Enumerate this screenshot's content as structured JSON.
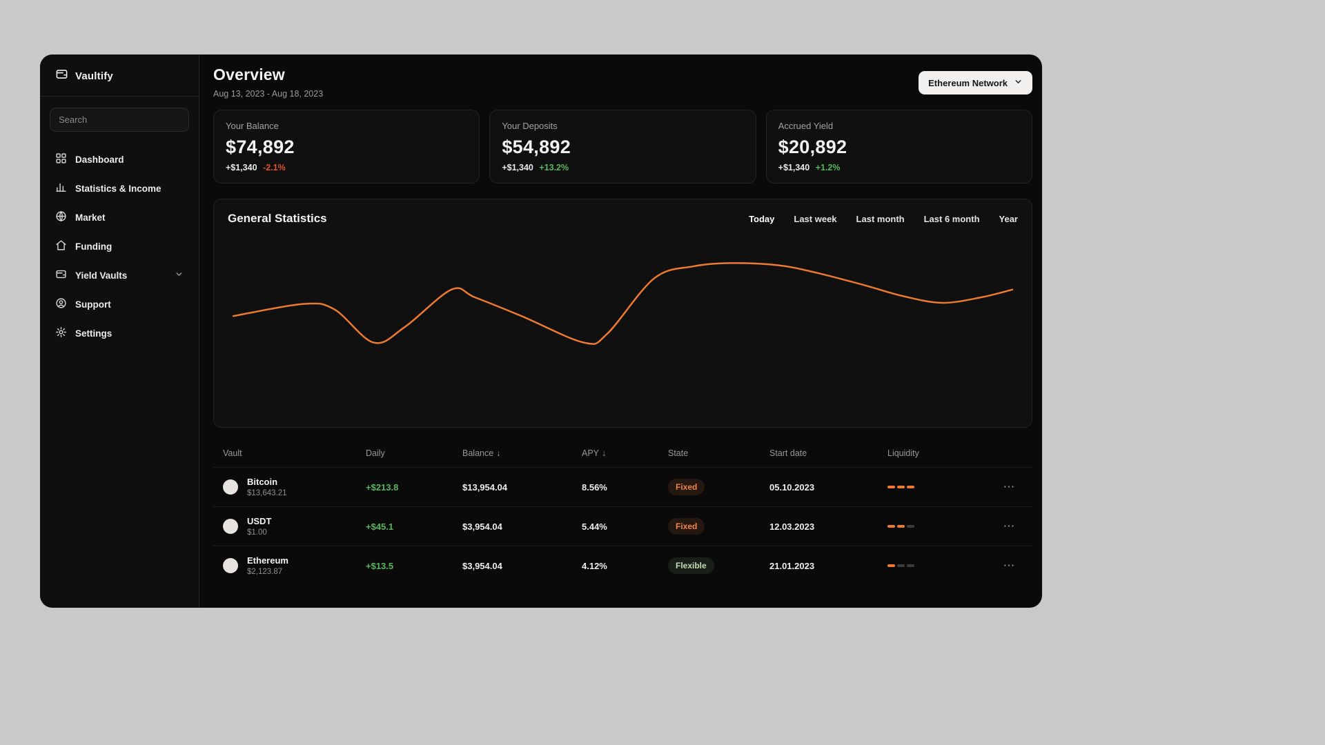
{
  "app": {
    "name": "Vaultify"
  },
  "colors": {
    "accent_orange": "#ed7a33",
    "positive_green": "#58b65c",
    "negative_red": "#e0532f",
    "window_bg": "#0a0a0a",
    "card_bg": "#101010"
  },
  "icons": {
    "sort_arrow": "↓",
    "ellipsis": "⋯"
  },
  "sidebar": {
    "search_placeholder": "Search",
    "items": [
      {
        "label": "Dashboard",
        "icon": "dashboard-grid"
      },
      {
        "label": "Statistics & Income",
        "icon": "bar-chart"
      },
      {
        "label": "Market",
        "icon": "globe"
      },
      {
        "label": "Funding",
        "icon": "home"
      },
      {
        "label": "Yield Vaults",
        "icon": "vault",
        "has_chevron": true
      },
      {
        "label": "Support",
        "icon": "user-circle"
      },
      {
        "label": "Settings",
        "icon": "gear"
      }
    ]
  },
  "header": {
    "title": "Overview",
    "date_range": "Aug 13, 2023 - Aug 18, 2023",
    "network_button": "Ethereum Network"
  },
  "stats": [
    {
      "label": "Your Balance",
      "value": "$74,892",
      "change_amount": "+$1,340",
      "change_percent": "-2.1%",
      "trend": "down"
    },
    {
      "label": "Your Deposits",
      "value": "$54,892",
      "change_amount": "+$1,340",
      "change_percent": "+13.2%",
      "trend": "up"
    },
    {
      "label": "Accrued Yield",
      "value": "$20,892",
      "change_amount": "+$1,340",
      "change_percent": "+1.2%",
      "trend": "up"
    }
  ],
  "statistics_card": {
    "title": "General Statistics",
    "ranges": [
      "Today",
      "Last week",
      "Last month",
      "Last 6 month",
      "Year"
    ],
    "active_range": "Today"
  },
  "chart_data": {
    "type": "line",
    "title": "General Statistics",
    "x": [
      0,
      9,
      13,
      18,
      22,
      28,
      31,
      37,
      45,
      48,
      54,
      59,
      64,
      70,
      75,
      81,
      86,
      91,
      96,
      100
    ],
    "y": [
      48,
      59,
      54,
      24,
      38,
      72,
      65,
      48,
      24,
      32,
      82,
      93,
      96,
      94,
      87,
      76,
      66,
      60,
      65,
      72
    ],
    "xlabel": "",
    "ylabel": "",
    "grid": false,
    "legend": false,
    "axes_visible": false,
    "line_color": "#ed7a33"
  },
  "table": {
    "columns": [
      {
        "label": "Vault"
      },
      {
        "label": "Daily"
      },
      {
        "label": "Balance",
        "sort": "desc"
      },
      {
        "label": "APY",
        "sort": "desc"
      },
      {
        "label": "State"
      },
      {
        "label": "Start date"
      },
      {
        "label": "Liquidity"
      }
    ],
    "rows": [
      {
        "name": "Bitcoin",
        "price": "$13,643.21",
        "daily": "+$213.8",
        "balance": "$13,954.04",
        "apy": "8.56%",
        "state": "Fixed",
        "state_type": "fixed",
        "start_date": "05.10.2023",
        "liquidity": 3
      },
      {
        "name": "USDT",
        "price": "$1.00",
        "daily": "+$45.1",
        "balance": "$3,954.04",
        "apy": "5.44%",
        "state": "Fixed",
        "state_type": "fixed",
        "start_date": "12.03.2023",
        "liquidity": 2
      },
      {
        "name": "Ethereum",
        "price": "$2,123.87",
        "daily": "+$13.5",
        "balance": "$3,954.04",
        "apy": "4.12%",
        "state": "Flexible",
        "state_type": "flexible",
        "start_date": "21.01.2023",
        "liquidity": 1
      }
    ]
  }
}
